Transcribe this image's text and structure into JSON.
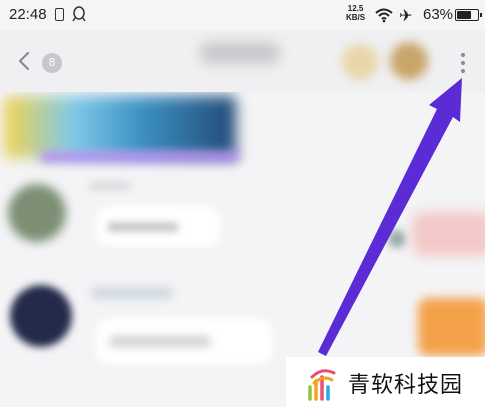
{
  "status_bar": {
    "time": "22:48",
    "net_speed_value": "12.5",
    "net_speed_unit": "KB/S",
    "battery_percent": "63%",
    "battery_level": 0.63,
    "icons": [
      "vibrate-icon",
      "qq-icon",
      "wifi-icon",
      "airplane-icon",
      "battery-icon"
    ]
  },
  "header": {
    "unread_count": "8",
    "icons": [
      "back-icon",
      "more-icon"
    ]
  },
  "watermark": {
    "text": "青软科技园"
  },
  "colors": {
    "arrow": "#5b2bd6",
    "background": "#f4f4f6",
    "icon_gray": "#8a8a8f"
  }
}
